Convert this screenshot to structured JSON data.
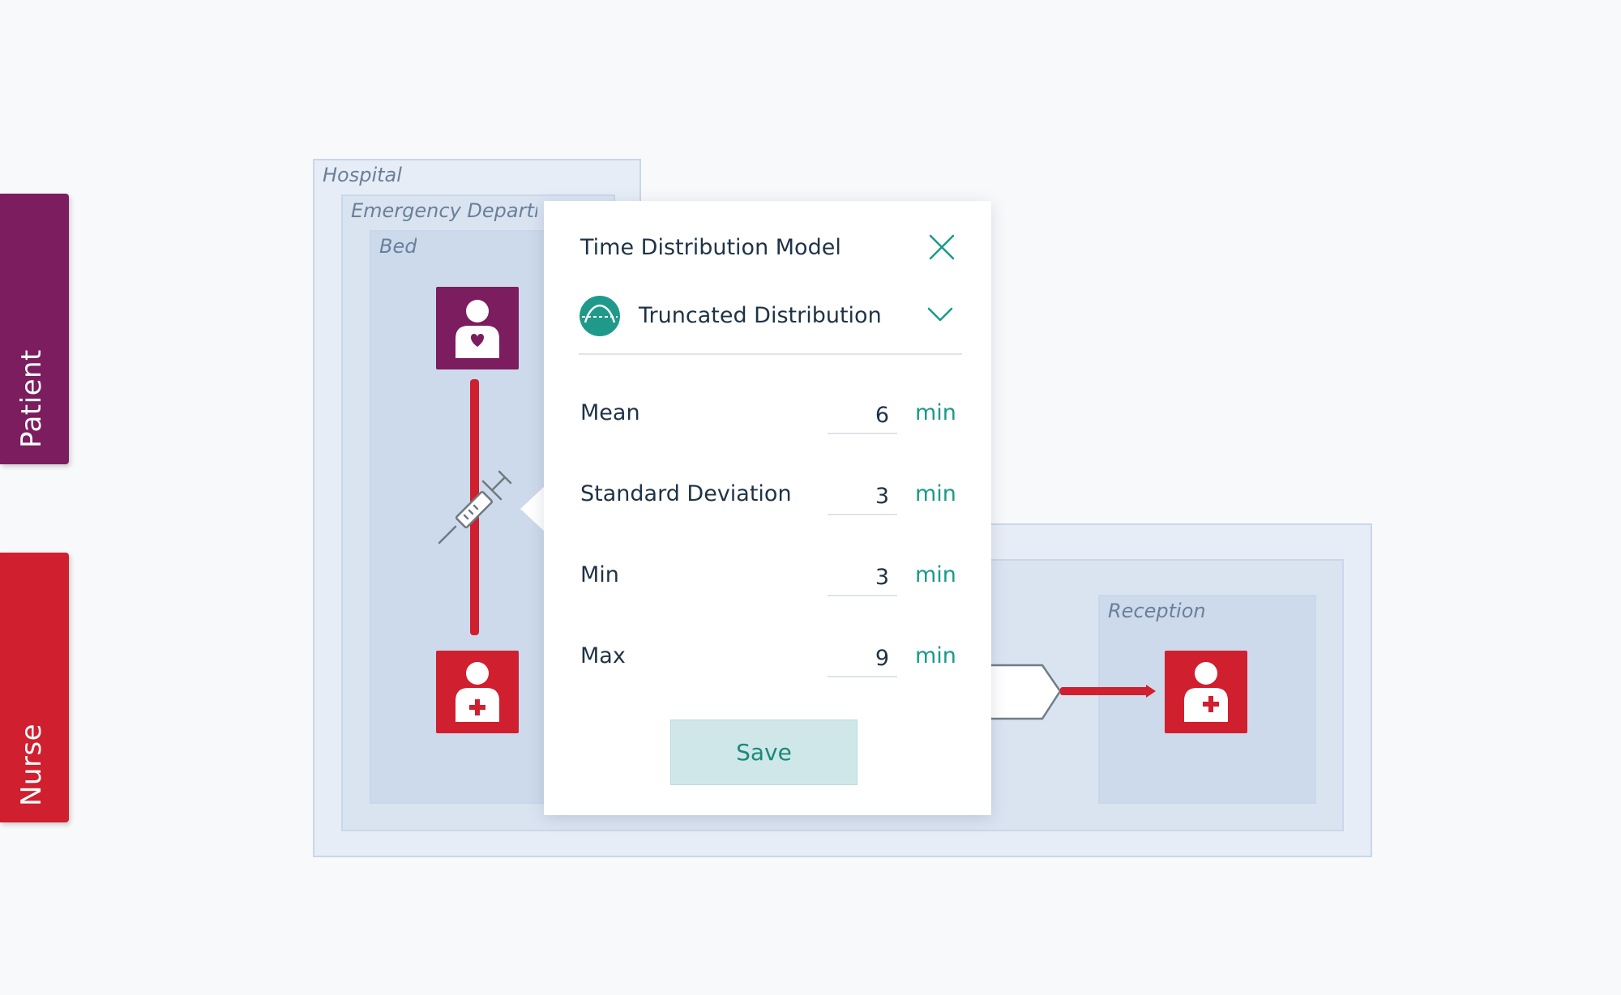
{
  "lanes": [
    {
      "label": "Patient",
      "color": "#7b1d5e"
    },
    {
      "label": "Nurse",
      "color": "#d01f2e"
    }
  ],
  "zones": {
    "hospital": "Hospital",
    "emergency": "Emergency Departm",
    "bed": "Bed",
    "reception": "Reception"
  },
  "icons": {
    "patient_node": "patient-heart-icon",
    "nurse_node": "nurse-cross-icon",
    "activity": "syringe-icon",
    "distribution": "truncated-distribution-icon"
  },
  "colors": {
    "patient": "#7b1d5e",
    "nurse": "#d01f2e",
    "accent": "#1a9a8a",
    "zone_outer": "#e6edf6",
    "zone_mid": "#dae4f1",
    "zone_inner": "#cddaeb"
  },
  "dialog": {
    "title": "Time Distribution Model",
    "distribution": "Truncated Distribution",
    "params": [
      {
        "label": "Mean",
        "value": "6",
        "unit": "min"
      },
      {
        "label": "Standard Deviation",
        "value": "3",
        "unit": "min"
      },
      {
        "label": "Min",
        "value": "3",
        "unit": "min"
      },
      {
        "label": "Max",
        "value": "9",
        "unit": "min"
      }
    ],
    "save_label": "Save"
  }
}
